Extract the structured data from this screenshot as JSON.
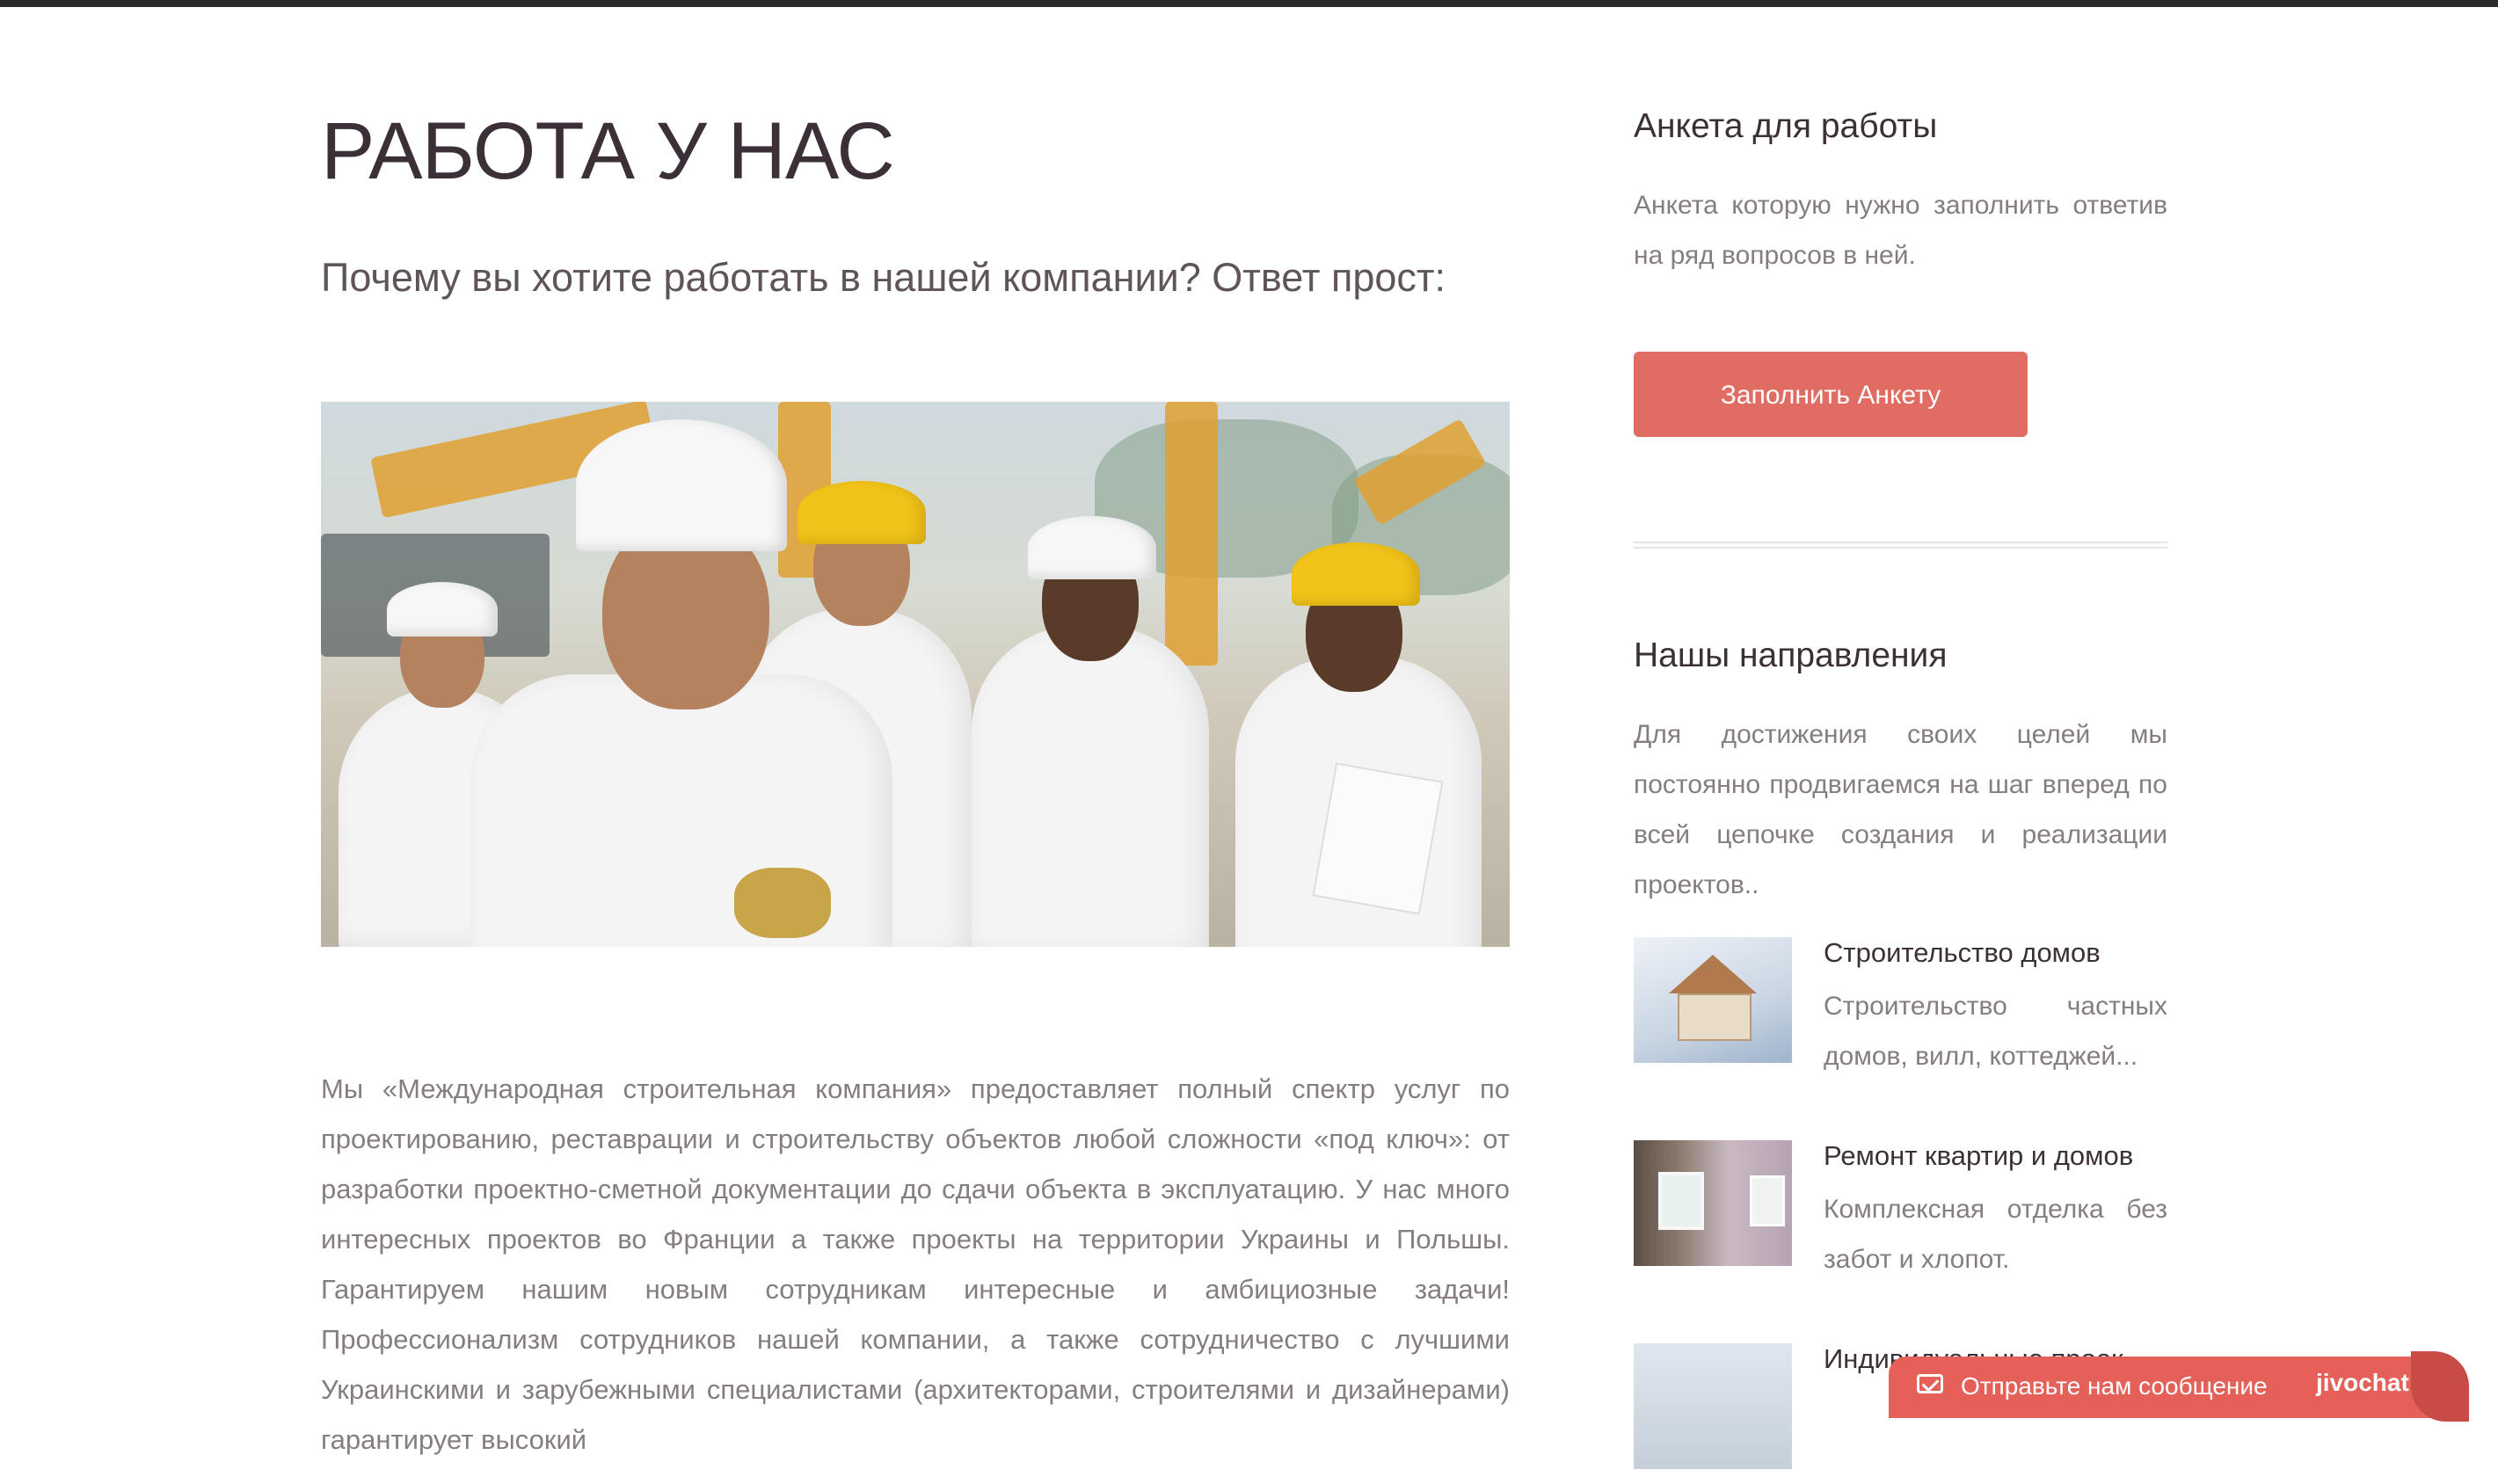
{
  "main": {
    "title": "РАБОТА У НАС",
    "subtitle": "Почему вы хотите работать в нашей компании? Ответ прост:",
    "body": "Мы «Международная строительная компания» предоставляет полный спектр услуг по проектированию, реставрации и строительству объектов любой сложности «под ключ»: от разработки проектно-сметной документации до сдачи объекта в эксплуатацию. У нас много интересных проектов во Франции а также проекты на территории Украины и Польшы. Гарантируем нашим новым сотрудникам интересные и амбициозные задачи! Профессионализм сотрудников нашей компании, а также сотрудничество с лучшими Украинскими и зарубежными специалистами (архитекторами, строителями и дизайнерами) гарантирует высокий"
  },
  "sidebar": {
    "application": {
      "title": "Анкета для работы",
      "text": "Анкета которую нужно заполнить ответив на ряд вопросов в ней.",
      "button_label": "Заполнить Анкету"
    },
    "directions": {
      "title": "Нашы направления",
      "text": "Для достижения своих целей мы постоянно продвигаемся на шаг вперед по всей цепочке создания и реализации проектов..",
      "items": [
        {
          "title": "Строительство домов",
          "description": "Строительство частных домов, вилл, коттеджей..."
        },
        {
          "title": "Ремонт квартир и домов",
          "description": "Комплексная отделка без забот и хлопот."
        },
        {
          "title": "Индивидуальные проек",
          "description": ""
        }
      ]
    }
  },
  "chat": {
    "label": "Отправьте нам сообщение",
    "brand": "jivochat",
    "color": "#e6605a"
  },
  "colors": {
    "accent": "#e06c63",
    "heading": "#3c3038",
    "text": "#857d80"
  }
}
